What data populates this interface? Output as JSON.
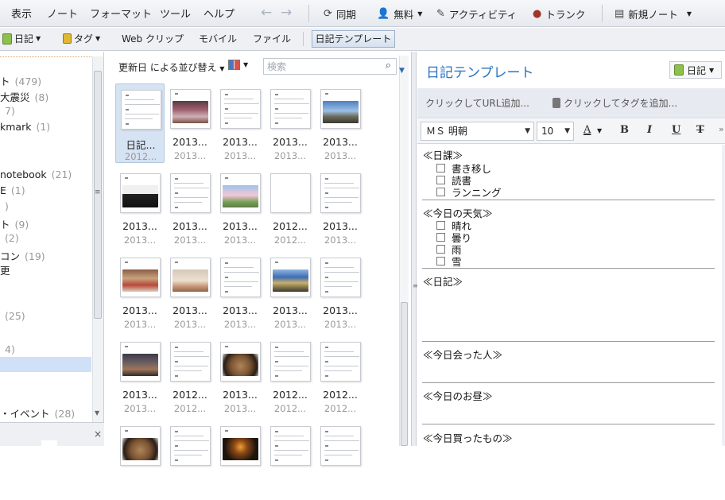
{
  "menubar": {
    "menus": [
      "表示",
      "ノート",
      "フォーマット",
      "ツール",
      "ヘルプ"
    ],
    "sync_label": "同期",
    "account_label": "無料",
    "activity_label": "アクティビティ",
    "trunk_label": "トランク",
    "new_note_label": "新規ノート"
  },
  "tabbar": {
    "notebook_label": "日記",
    "tag_label": "タグ",
    "webclip_label": "Web クリップ",
    "mobile_label": "モバイル",
    "file_label": "ファイル",
    "active_tab_label": "日記テンプレート"
  },
  "left_panel": {
    "items": [
      {
        "label": "ト",
        "count": "(479)"
      },
      {
        "label": "大震災",
        "count": "(8)"
      },
      {
        "label": "",
        "count": "7)"
      },
      {
        "label": "kmark",
        "count": "(1)"
      },
      {
        "label": "notebook",
        "count": "(21)"
      },
      {
        "label": "E",
        "count": "(1)"
      },
      {
        "label": "",
        "count": ")"
      },
      {
        "label": "ト",
        "count": "(9)"
      },
      {
        "label": "",
        "count": "(2)"
      },
      {
        "label": "コン",
        "count": "(19)"
      },
      {
        "label": "更",
        "count": ""
      },
      {
        "label": "",
        "count": "(25)"
      },
      {
        "label": "",
        "count": "4)"
      },
      {
        "label": "・イベント",
        "count": "(28)"
      }
    ],
    "close_glyph": "×"
  },
  "list": {
    "sort_label": "更新日 による並び替え",
    "search_placeholder": "検索",
    "notes": [
      {
        "title": "日記...",
        "date": "2012...",
        "thumb": "text"
      },
      {
        "title": "2013...",
        "date": "2013...",
        "thumb": "photo-red"
      },
      {
        "title": "2013...",
        "date": "2013...",
        "thumb": "text"
      },
      {
        "title": "2013...",
        "date": "2013...",
        "thumb": "text"
      },
      {
        "title": "2013...",
        "date": "2013...",
        "thumb": "photo-sky"
      },
      {
        "title": "2013...",
        "date": "2013...",
        "thumb": "photo-bag"
      },
      {
        "title": "2013...",
        "date": "2013...",
        "thumb": "text"
      },
      {
        "title": "2013...",
        "date": "2013...",
        "thumb": "photo-tree"
      },
      {
        "title": "2012...",
        "date": "2012...",
        "thumb": "blank"
      },
      {
        "title": "2013...",
        "date": "2013...",
        "thumb": "text"
      },
      {
        "title": "2013...",
        "date": "2013...",
        "thumb": "photo-room"
      },
      {
        "title": "2013...",
        "date": "2013...",
        "thumb": "photo-wall"
      },
      {
        "title": "2013...",
        "date": "2013...",
        "thumb": "text"
      },
      {
        "title": "2013...",
        "date": "2013...",
        "thumb": "photo-train"
      },
      {
        "title": "2013...",
        "date": "2013...",
        "thumb": "text"
      },
      {
        "title": "2013...",
        "date": "2013...",
        "thumb": "photo-crowd"
      },
      {
        "title": "2012...",
        "date": "2012...",
        "thumb": "text"
      },
      {
        "title": "2013...",
        "date": "2013...",
        "thumb": "photo-noodle"
      },
      {
        "title": "2012...",
        "date": "2012...",
        "thumb": "text"
      },
      {
        "title": "2012...",
        "date": "2012...",
        "thumb": "text"
      },
      {
        "title": "",
        "date": "",
        "thumb": "photo-noodle"
      },
      {
        "title": "",
        "date": "",
        "thumb": "text"
      },
      {
        "title": "",
        "date": "",
        "thumb": "photo-dark"
      },
      {
        "title": "",
        "date": "",
        "thumb": "text"
      },
      {
        "title": "",
        "date": "",
        "thumb": "text"
      }
    ]
  },
  "editor": {
    "title": "日記テンプレート",
    "notebook_label": "日記",
    "url_placeholder": "クリックしてURL追加...",
    "tag_placeholder": "クリックしてタグを追加...",
    "font_name": "ＭＳ 明朝",
    "font_size": "10",
    "format_buttons": [
      "A",
      "B",
      "I",
      "U",
      "T"
    ],
    "sections": {
      "daily_tasks": "≪日課≫",
      "tasks": [
        "書き移し",
        "読書",
        "ランニング"
      ],
      "weather_heading": "≪今日の天気≫",
      "weather": [
        "晴れ",
        "曇り",
        "雨",
        "雪"
      ],
      "diary_heading": "≪日記≫",
      "people_heading": "≪今日会った人≫",
      "lunch_heading": "≪今日のお昼≫",
      "purchases_heading": "≪今日買ったもの≫"
    }
  }
}
